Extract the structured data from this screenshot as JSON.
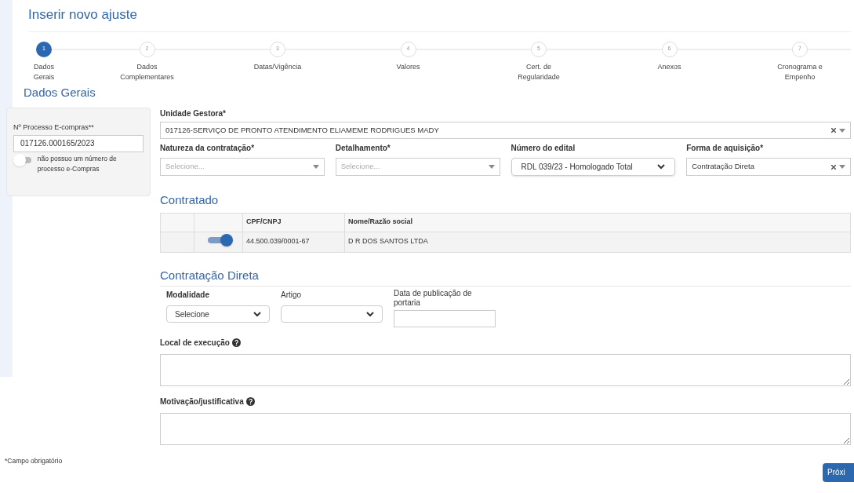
{
  "page_title": "Inserir novo ajuste",
  "steps": [
    {
      "number": "1",
      "label": "Dados Gerais",
      "selected": true
    },
    {
      "number": "2",
      "label": "Dados Complementares",
      "selected": false
    },
    {
      "number": "3",
      "label": "Datas/Vigência",
      "selected": false
    },
    {
      "number": "4",
      "label": "Valores",
      "selected": false
    },
    {
      "number": "5",
      "label": "Cert. de Regularidade",
      "selected": false
    },
    {
      "number": "6",
      "label": "Anexos",
      "selected": false
    },
    {
      "number": "7",
      "label": "Cronograma e Empenho",
      "selected": false
    }
  ],
  "section_title": "Dados Gerais",
  "side_panel": {
    "label": "Nº Processo E-compras**",
    "value": "017126.000165/2023",
    "toggle_on": false,
    "toggle_label": "não possuo um número de processo e-Compras"
  },
  "unidade_gestora": {
    "label": "Unidade Gestora*",
    "value": "017126-SERVIÇO DE PRONTO ATENDIMENTO ELIAMEME RODRIGUES MADY"
  },
  "row_fields": [
    {
      "kind": "select2",
      "label": "Natureza da contratação*",
      "placeholder": "Selecione..."
    },
    {
      "kind": "select2",
      "label": "Detalhamento*",
      "placeholder": "Selecione..."
    },
    {
      "kind": "native",
      "label": "Número do edital",
      "value": "RDL 039/23 - Homologado Total"
    },
    {
      "kind": "clearable",
      "label": "Forma de aquisição*",
      "value": "Contratação Direta"
    }
  ],
  "contratado": {
    "title": "Contratado",
    "columns": [
      "CPF/CNPJ",
      "Nome/Razão social"
    ],
    "rows": [
      {
        "on": true,
        "cpf": "44.500.039/0001-67",
        "name": "D R DOS SANTOS LTDA"
      }
    ]
  },
  "direta": {
    "title": "Contratação Direta",
    "modalidade": {
      "label": "Modalidade",
      "value": "Selecione"
    },
    "artigo": {
      "label": "Artigo"
    },
    "data": {
      "label": "Data de publicação de portaria"
    },
    "local": {
      "label": "Local de execução"
    },
    "motivacao": {
      "label": "Motivação/justificativa"
    }
  },
  "footnote": "*Campo obrigatório",
  "next_button": "Próxi"
}
